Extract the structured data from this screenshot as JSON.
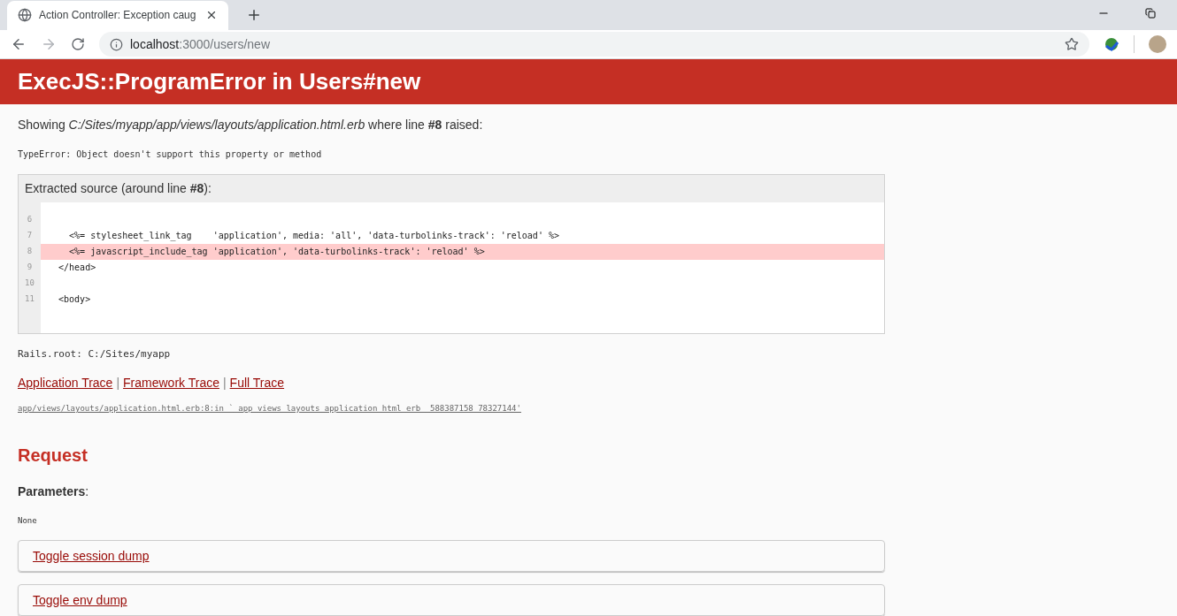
{
  "browser": {
    "tab": {
      "title": "Action Controller: Exception caug",
      "selected": true
    },
    "address": {
      "host": "localhost",
      "path": ":3000/users/new"
    }
  },
  "header": {
    "title": "ExecJS::ProgramError in Users#new"
  },
  "showing": "Showing *C:/Sites/myapp/app/views/layouts/application.html.erb* where line **#8** raised:",
  "error": "TypeError: Object doesn't support this property or method",
  "source": {
    "title": "Extracted source (around line **#8**):",
    "lines": [
      {
        "number": "6",
        "highlighted": false
      },
      {
        "number": "7",
        "code": "    <%= stylesheet_link_tag    'application', media: 'all', 'data-turbolinks-track': 'reload' %>",
        "highlighted": false
      },
      {
        "number": "8",
        "code": "    <%= javascript_include_tag 'application', 'data-turbolinks-track': 'reload' %>",
        "highlighted": true
      },
      {
        "number": "9",
        "code": "  </head>",
        "highlighted": false
      },
      {
        "number": "10",
        "highlighted": false
      },
      {
        "number": "11",
        "code": "  <body>",
        "highlighted": false
      }
    ]
  },
  "rails_root": "Rails.root: C:/Sites/myapp",
  "trace_links": [
    "Application Trace",
    "Framework Trace",
    "Full Trace"
  ],
  "trace_separator": "|",
  "trace_line": "app/views/layouts/application.html.erb:8:in `_app_views_layouts_application_html_erb__588387158_78327144'",
  "request": {
    "heading": "Request",
    "parameters_label": "Parameters",
    "parameters_colon": ":",
    "parameters_value": "None",
    "toggles": [
      "Toggle session dump",
      "Toggle env dump"
    ]
  }
}
